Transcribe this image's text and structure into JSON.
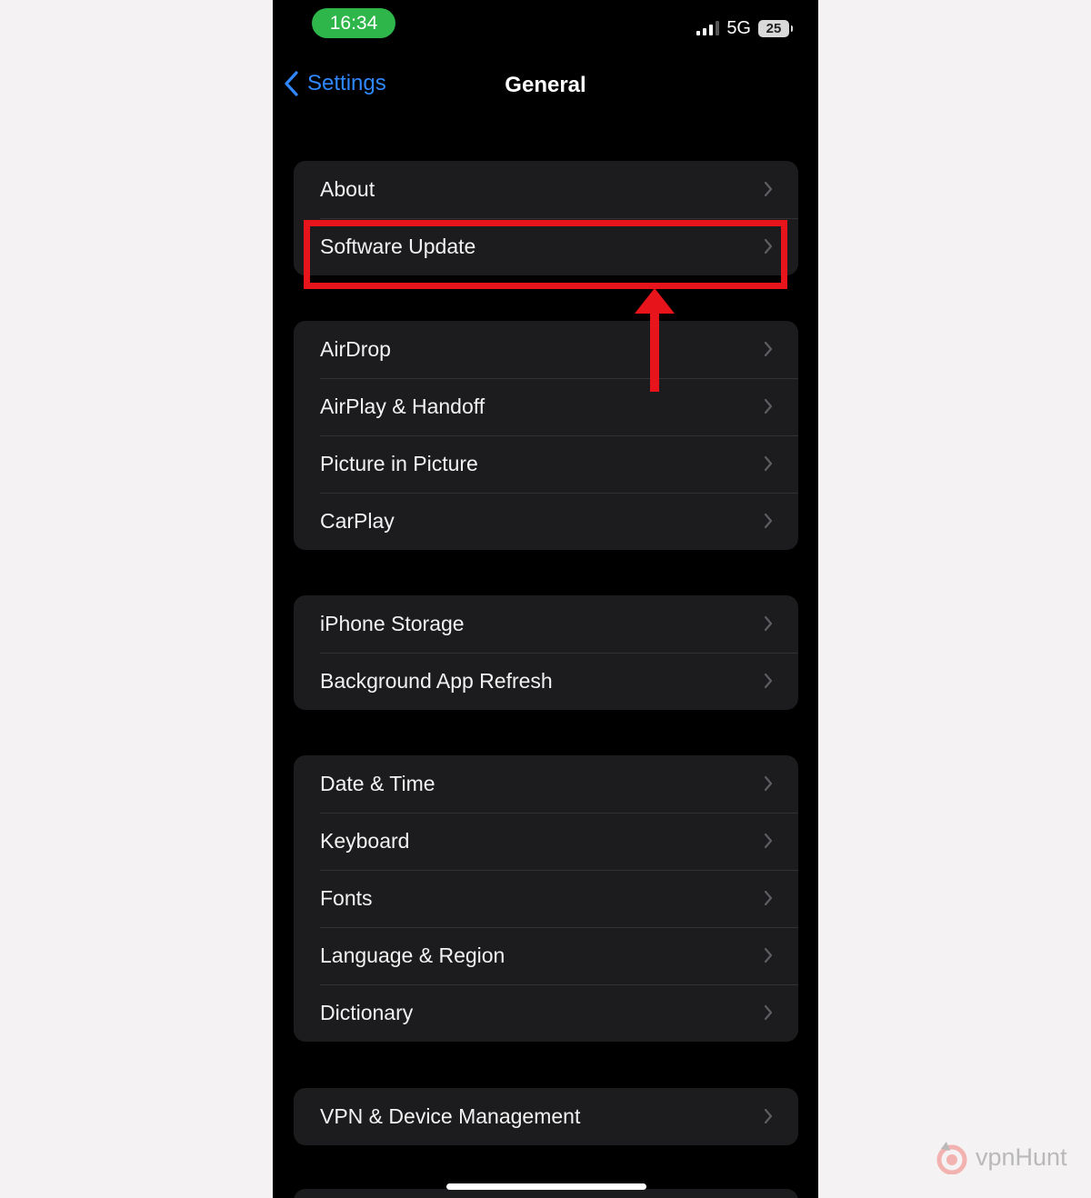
{
  "status_bar": {
    "time": "16:34",
    "network": "5G",
    "battery": "25"
  },
  "nav": {
    "back_label": "Settings",
    "title": "General"
  },
  "groups": [
    {
      "rows": [
        {
          "label": "About"
        },
        {
          "label": "Software Update"
        }
      ]
    },
    {
      "rows": [
        {
          "label": "AirDrop"
        },
        {
          "label": "AirPlay & Handoff"
        },
        {
          "label": "Picture in Picture"
        },
        {
          "label": "CarPlay"
        }
      ]
    },
    {
      "rows": [
        {
          "label": "iPhone Storage"
        },
        {
          "label": "Background App Refresh"
        }
      ]
    },
    {
      "rows": [
        {
          "label": "Date & Time"
        },
        {
          "label": "Keyboard"
        },
        {
          "label": "Fonts"
        },
        {
          "label": "Language & Region"
        },
        {
          "label": "Dictionary"
        }
      ]
    },
    {
      "rows": [
        {
          "label": "VPN & Device Management"
        }
      ]
    }
  ],
  "annotation": {
    "highlighted_row": "Software Update",
    "color": "#e8141b"
  },
  "colors": {
    "accent": "#2f88ff",
    "cell_background": "#1c1c1e",
    "time_pill": "#2fb64b"
  },
  "watermark": {
    "text": "vpnHunt"
  }
}
